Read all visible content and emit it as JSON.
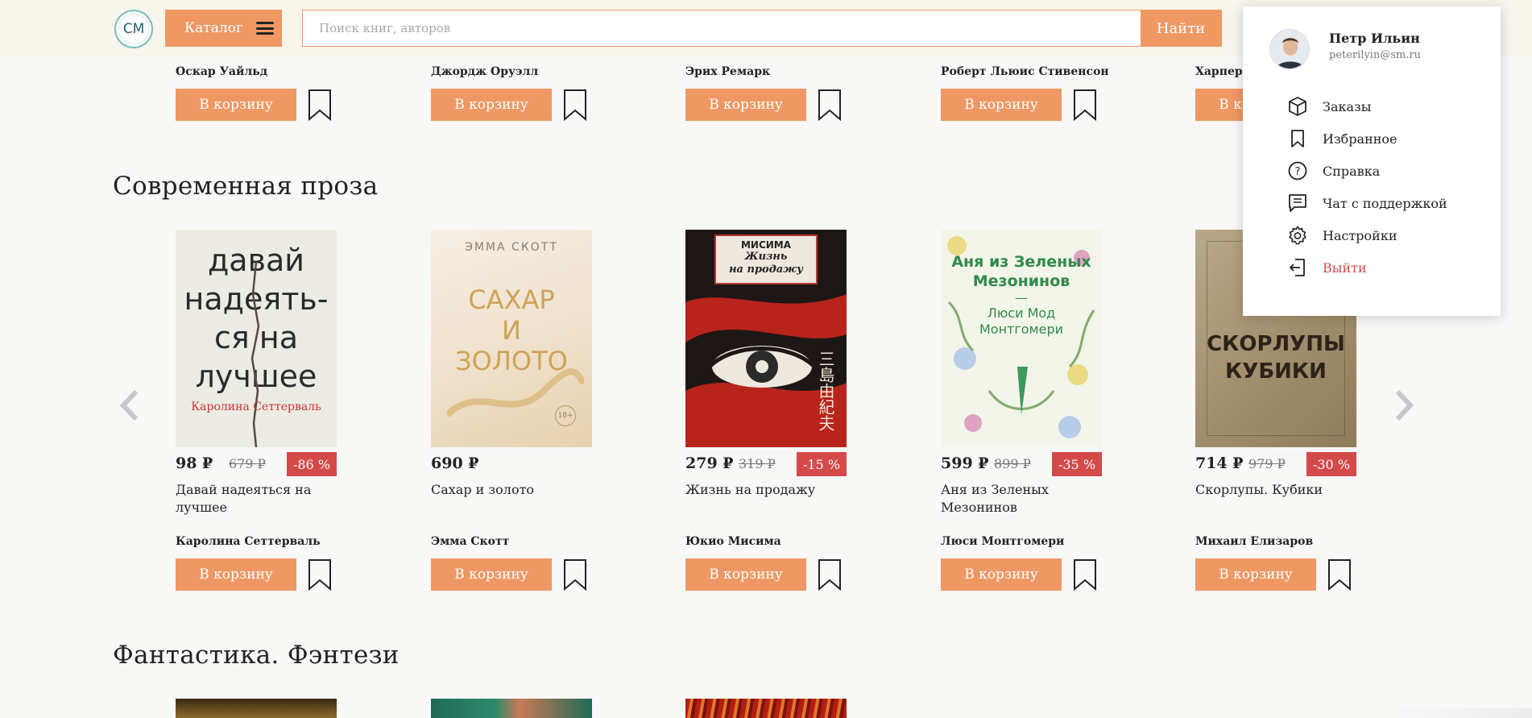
{
  "header": {
    "logo_text": "CM",
    "catalog_label": "Каталог",
    "search_placeholder": "Поиск книг, авторов",
    "search_button": "Найти"
  },
  "top_row": {
    "authors": [
      "Оскар Уайльд",
      "Джордж Оруэлл",
      "Эрих Ремарк",
      "Роберт Льюис Стивенсон",
      "Харпер Ли"
    ]
  },
  "cart_label": "В корзину",
  "sections": [
    {
      "title": "Современная проза",
      "books": [
        {
          "title": "Давай надеяться на лучшее",
          "author": "Каролина Сеттерваль",
          "price": "98 ₽",
          "old_price": "679 ₽",
          "discount": "-86 %",
          "cover_lines": [
            "давай",
            "надеять-",
            "ся на",
            "лучшее"
          ],
          "cover_author": "Каролина Сеттерваль"
        },
        {
          "title": "Сахар и золото",
          "author": "Эмма Скотт",
          "price": "690 ₽",
          "old_price": "",
          "discount": "",
          "cover_author": "ЭММА СКОТТ",
          "cover_lines": [
            "САХАР",
            "И",
            "ЗОЛОТО"
          ],
          "cover_badge": "18+"
        },
        {
          "title": "Жизнь на продажу",
          "author": "Юкио Мисима",
          "price": "279 ₽",
          "old_price": "319 ₽",
          "discount": "-15 %",
          "cover_author": "МИСИМА",
          "cover_lines": [
            "Жизнь",
            "на продажу"
          ],
          "cover_kanji": "三島由紀夫"
        },
        {
          "title": "Аня из Зеленых Мезонинов",
          "author": "Люси Монтгомери",
          "price": "599 ₽",
          "old_price": "899 ₽",
          "discount": "-35 %",
          "cover_lines": [
            "Аня из Зеленых",
            "Мезонинов",
            "—",
            "Люси Мод",
            "Монтгомери"
          ]
        },
        {
          "title": "Скорлупы. Кубики",
          "author": "Михаил Елизаров",
          "price": "714 ₽",
          "old_price": "979 ₽",
          "discount": "-30 %",
          "cover_lines": [
            "СКОРЛУПЫ",
            "КУБИКИ"
          ]
        }
      ]
    },
    {
      "title": "Фантастика. Фэнтези"
    }
  ],
  "user_menu": {
    "name": "Петр Ильин",
    "email": "peterilyin@sm.ru",
    "items": [
      {
        "label": "Заказы",
        "icon": "box-icon"
      },
      {
        "label": "Избранное",
        "icon": "bookmark-icon"
      },
      {
        "label": "Справка",
        "icon": "help-icon"
      },
      {
        "label": "Чат с поддержкой",
        "icon": "chat-icon"
      },
      {
        "label": "Настройки",
        "icon": "gear-icon"
      },
      {
        "label": "Выйти",
        "icon": "logout-icon"
      }
    ]
  },
  "colors": {
    "accent": "#ef9864",
    "discount": "#d44a4a",
    "header_bg": "#f7f5ec",
    "logout": "#d24d4d"
  }
}
